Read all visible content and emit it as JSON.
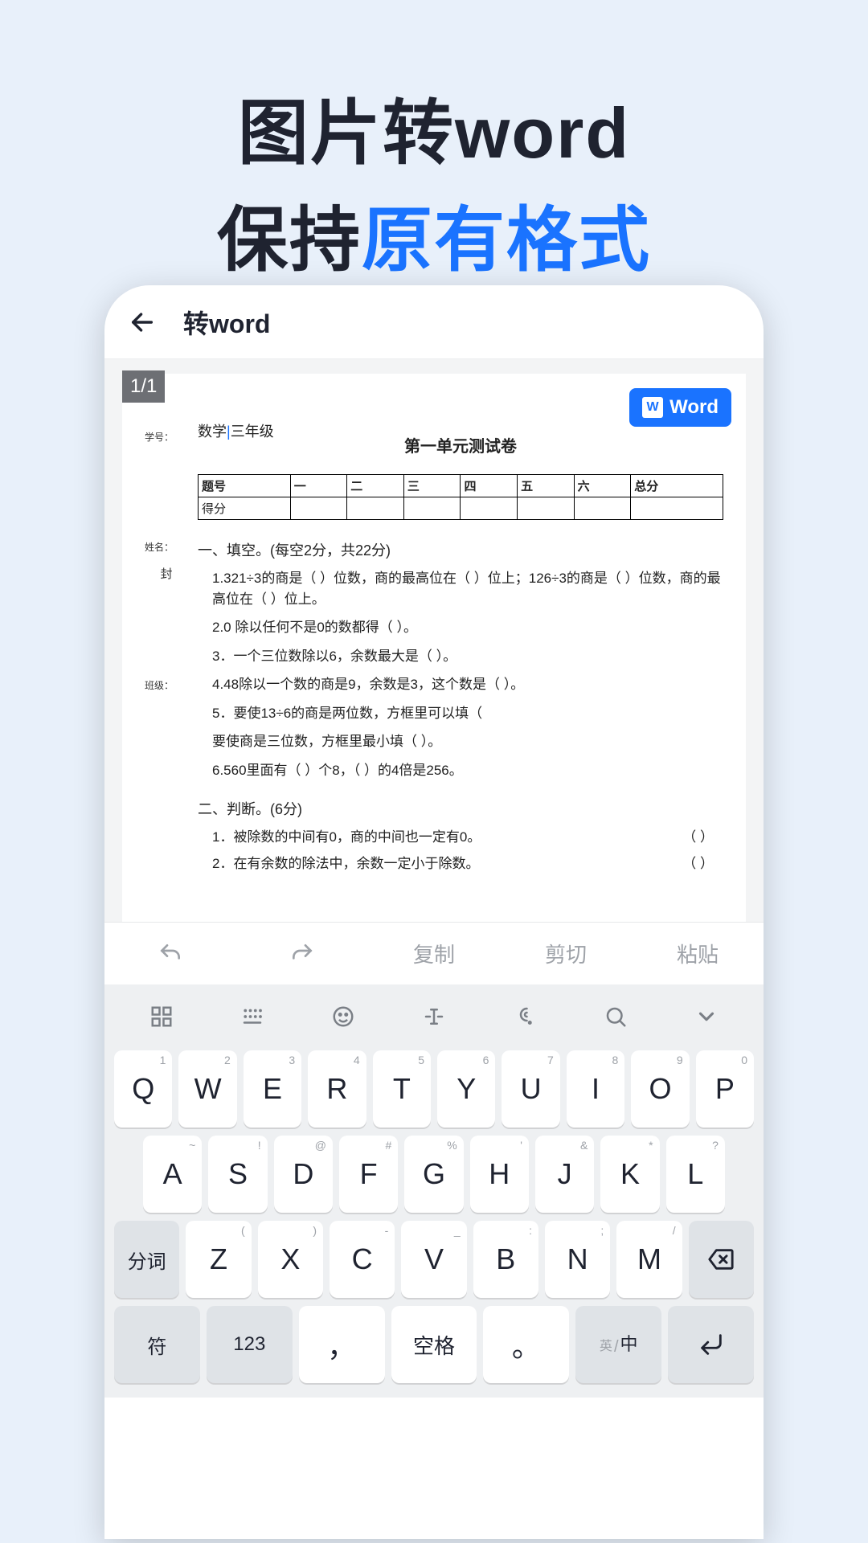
{
  "hero": {
    "line1": "图片转word",
    "line2_a": "保持",
    "line2_b": "原有格式"
  },
  "appbar": {
    "title": "转word"
  },
  "doc": {
    "page_indicator": "1/1",
    "word_button": "Word",
    "margin_labels": [
      "学号：",
      "姓名：",
      "封",
      "班级："
    ],
    "subject_prefix": "数学",
    "subject_grade": "三年级",
    "title": "第一单元测试卷",
    "table": {
      "row1_label": "题号",
      "cols": [
        "一",
        "二",
        "三",
        "四",
        "五",
        "六",
        "总分"
      ],
      "row2_label": "得分"
    },
    "section1_h": "一、填空。(每空2分，共22分)",
    "q1": "1.321÷3的商是（  ）位数，商的最高位在（ ）位上；126÷3的商是（  ）位数，商的最高位在（  ）位上。",
    "q2": "2.0 除以任何不是0的数都得（  ）。",
    "q3": "3．一个三位数除以6，余数最大是（  ）。",
    "q4": "4.48除以一个数的商是9，余数是3，这个数是（  ）。",
    "q5a": "5．要使13÷6的商是两位数，方框里可以填（",
    "q5b": "要使商是三位数，方框里最小填（  ）。",
    "q6": "6.560里面有（  ）个8，（  ）的4倍是256。",
    "section2_h": "二、判断。(6分)",
    "j1": "1．被除数的中间有0，商的中间也一定有0。",
    "j2": "2．在有余数的除法中，余数一定小于除数。",
    "paren": "（    ）"
  },
  "toolbar": {
    "copy": "复制",
    "cut": "剪切",
    "paste": "粘贴"
  },
  "keyboard": {
    "row1": [
      {
        "k": "Q",
        "h": "1"
      },
      {
        "k": "W",
        "h": "2"
      },
      {
        "k": "E",
        "h": "3"
      },
      {
        "k": "R",
        "h": "4"
      },
      {
        "k": "T",
        "h": "5"
      },
      {
        "k": "Y",
        "h": "6"
      },
      {
        "k": "U",
        "h": "7"
      },
      {
        "k": "I",
        "h": "8"
      },
      {
        "k": "O",
        "h": "9"
      },
      {
        "k": "P",
        "h": "0"
      }
    ],
    "row2": [
      {
        "k": "A",
        "h": "~"
      },
      {
        "k": "S",
        "h": "!"
      },
      {
        "k": "D",
        "h": "@"
      },
      {
        "k": "F",
        "h": "#"
      },
      {
        "k": "G",
        "h": "%"
      },
      {
        "k": "H",
        "h": "'"
      },
      {
        "k": "J",
        "h": "&"
      },
      {
        "k": "K",
        "h": "*"
      },
      {
        "k": "L",
        "h": "?"
      }
    ],
    "row3_left": "分词",
    "row3": [
      {
        "k": "Z",
        "h": "("
      },
      {
        "k": "X",
        "h": ")"
      },
      {
        "k": "C",
        "h": "-"
      },
      {
        "k": "V",
        "h": "_"
      },
      {
        "k": "B",
        "h": ":"
      },
      {
        "k": "N",
        "h": ";"
      },
      {
        "k": "M",
        "h": "/"
      }
    ],
    "row4": {
      "sym": "符",
      "num": "123",
      "comma": "，",
      "space": "空格",
      "period": "。",
      "lang_en": "英",
      "lang_zh": "中"
    }
  }
}
